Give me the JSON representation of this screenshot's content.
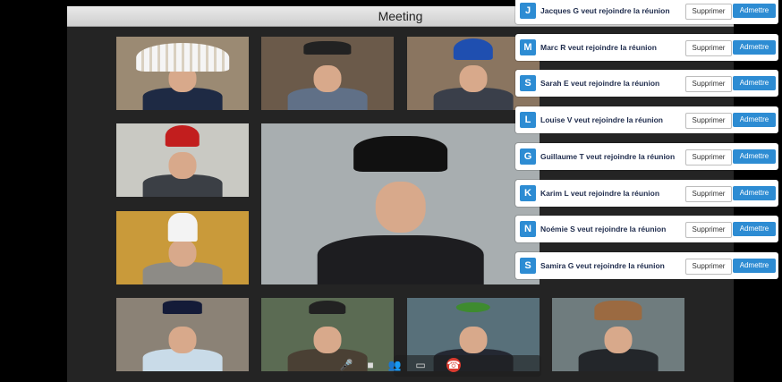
{
  "window": {
    "title": "Meeting"
  },
  "participants": [
    {
      "id": "feather",
      "bg": "#9b8a73",
      "shirt": "#1e2a44",
      "hat": "feather"
    },
    {
      "id": "fedora1",
      "bg": "#6b5a4a",
      "shirt": "#607087",
      "hat": "fedora"
    },
    {
      "id": "helmet",
      "bg": "#8a7560",
      "shirt": "#3a3f4a",
      "hat": "helmet"
    },
    {
      "id": "beanie",
      "bg": "#c9c9c3",
      "shirt": "#3b3f45",
      "hat": "beanie"
    },
    {
      "id": "chef",
      "bg": "#c99a3a",
      "shirt": "#8d8b86",
      "hat": "chef"
    },
    {
      "id": "captain",
      "bg": "#8b8276",
      "shirt": "#c9dbe8",
      "hat": "captain"
    },
    {
      "id": "flatcap",
      "bg": "#5b6b53",
      "shirt": "#4a4034",
      "hat": "flatcap"
    },
    {
      "id": "wreath",
      "bg": "#58707a",
      "shirt": "#242832",
      "hat": "wreath"
    },
    {
      "id": "cowboy",
      "bg": "#6f7c7e",
      "shirt": "#23262a",
      "hat": "cowboy"
    },
    {
      "id": "main",
      "bg": "#a8aeb0",
      "shirt": "#1d1d20",
      "hat": "black-fedora"
    }
  ],
  "requests": [
    {
      "initial": "J",
      "text": "Jacques G veut rejoindre la réunion",
      "decline": "Supprimer",
      "accept": "Admettre"
    },
    {
      "initial": "M",
      "text": "Marc R veut rejoindre la réunion",
      "decline": "Supprimer",
      "accept": "Admettre"
    },
    {
      "initial": "S",
      "text": "Sarah E veut rejoindre la réunion",
      "decline": "Supprimer",
      "accept": "Admettre"
    },
    {
      "initial": "L",
      "text": "Louise V veut rejoindre la réunion",
      "decline": "Supprimer",
      "accept": "Admettre"
    },
    {
      "initial": "G",
      "text": "Guillaume T veut rejoindre la réunion",
      "decline": "Supprimer",
      "accept": "Admettre"
    },
    {
      "initial": "K",
      "text": "Karim L veut rejoindre la réunion",
      "decline": "Supprimer",
      "accept": "Admettre"
    },
    {
      "initial": "N",
      "text": "Noémie S veut rejoindre la réunion",
      "decline": "Supprimer",
      "accept": "Admettre"
    },
    {
      "initial": "S",
      "text": "Samira G veut rejoindre la réunion",
      "decline": "Supprimer",
      "accept": "Admettre"
    }
  ],
  "controls": [
    {
      "name": "microphone-icon",
      "glyph": "🎤"
    },
    {
      "name": "camera-icon",
      "glyph": "■"
    },
    {
      "name": "participants-icon",
      "glyph": "👥"
    },
    {
      "name": "chat-icon",
      "glyph": "▭"
    },
    {
      "name": "end-call-icon",
      "glyph": "☎"
    }
  ],
  "colors": {
    "accent": "#2d8cd3",
    "end_call": "#d93a2f"
  }
}
